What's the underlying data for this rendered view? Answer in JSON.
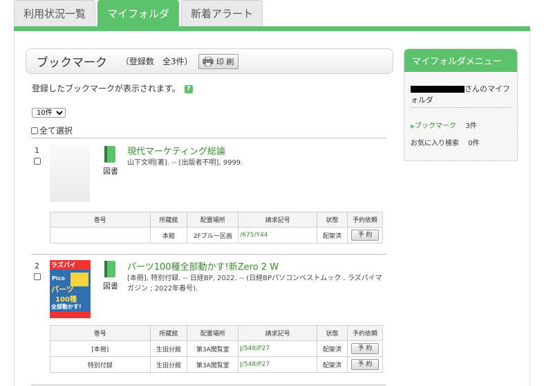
{
  "tabs": [
    {
      "label": "利用状況一覧",
      "active": false
    },
    {
      "label": "マイフォルダ",
      "active": true
    },
    {
      "label": "新着アラート",
      "active": false
    }
  ],
  "accent_color": "#5cc26b",
  "header": {
    "title": "ブックマーク",
    "count_text": "（登録数　全3件）",
    "print_label": "印 刷"
  },
  "description": "登録したブックマークが表示されます。",
  "help_icon_text": "?",
  "per_page": {
    "selected": "10件"
  },
  "select_all_label": "全て選択",
  "items": [
    {
      "number": "1",
      "type": "図書",
      "title": "現代マーケティング総論",
      "meta": "山下文明[著]. -- [出版者不明], 9999.",
      "columns": [
        "巻号",
        "所蔵館",
        "配置場所",
        "請求記号",
        "状態",
        "予約依頼"
      ],
      "rows": [
        {
          "volume": "",
          "library": "本館",
          "location": "2Fブルー区画",
          "call": "/675/Y44",
          "status": "配架済",
          "reserve": "予 約"
        }
      ]
    },
    {
      "number": "2",
      "type": "図書",
      "title": "パーツ100種全部動かす!新Zero 2 W",
      "meta": "[本冊], 特別付録. -- 日経BP, 2022. -- (日経BPパソコンベストムック . ラズパイマガジン ; 2022年春号).",
      "columns": [
        "巻号",
        "所蔵館",
        "配置場所",
        "請求記号",
        "状態",
        "予約依頼"
      ],
      "rows": [
        {
          "volume": "[本冊]",
          "library": "生田分館",
          "location": "第3A閲覧室",
          "call": "J/548/P27",
          "status": "配架済",
          "reserve": "予 約"
        },
        {
          "volume": "特別付録",
          "library": "生田分館",
          "location": "第3A閲覧室",
          "call": "J/548/P27",
          "status": "配架済",
          "reserve": "予 約"
        }
      ]
    }
  ],
  "cover_text": {
    "line1": "ラズパイ",
    "line2": "Pico",
    "line3": "パーツ",
    "line4": "100種",
    "line5": "全部動かす!"
  },
  "sidebar": {
    "title": "マイフォルダメニュー",
    "owner_suffix": "さんのマイフォルダ",
    "bookmark_label": "ブックマーク",
    "bookmark_count": "3件",
    "saved_search_label": "お気に入り検索",
    "saved_search_count": "0件"
  }
}
